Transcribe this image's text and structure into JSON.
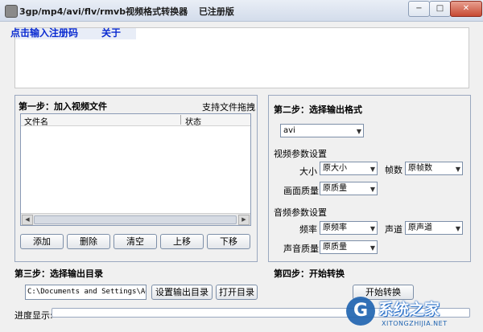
{
  "window": {
    "title": "3gp/mp4/avi/flv/rmvb视频格式转换器",
    "status": "已注册版",
    "minimize_glyph": "−",
    "maximize_glyph": "□",
    "close_glyph": "✕"
  },
  "menu": {
    "register": "点击输入注册码",
    "about": "关于"
  },
  "step1": {
    "heading": "第一步：加入视频文件",
    "drag_hint": "支持文件拖拽",
    "columns": [
      "文件名",
      "状态"
    ],
    "buttons": {
      "add": "添加",
      "delete": "删除",
      "clear": "清空",
      "up": "上移",
      "down": "下移"
    }
  },
  "step2": {
    "heading": "第二步：选择输出格式",
    "format": "avi",
    "video_section": "视频参数设置",
    "size_label": "大小",
    "size_value": "原大小",
    "fps_label": "帧数",
    "fps_value": "原帧数",
    "quality_label": "画面质量",
    "quality_value": "原质量",
    "audio_section": "音频参数设置",
    "rate_label": "频率",
    "rate_value": "原频率",
    "channel_label": "声道",
    "channel_value": "原声道",
    "audio_quality_label": "声音质量",
    "audio_quality_value": "原质量"
  },
  "step3": {
    "heading": "第三步：选择输出目录",
    "dir_value": "C:\\Documents and Settings\\Admir",
    "set_dir": "设置输出目录",
    "open_dir": "打开目录"
  },
  "step4": {
    "heading": "第四步：开始转换",
    "start": "开始转换"
  },
  "progress": {
    "label": "进度显示:",
    "value_percent": 0
  },
  "watermark": {
    "logo_glyph": "G",
    "text": "系统之家",
    "url": "XITONGZHIJIA.NET"
  }
}
